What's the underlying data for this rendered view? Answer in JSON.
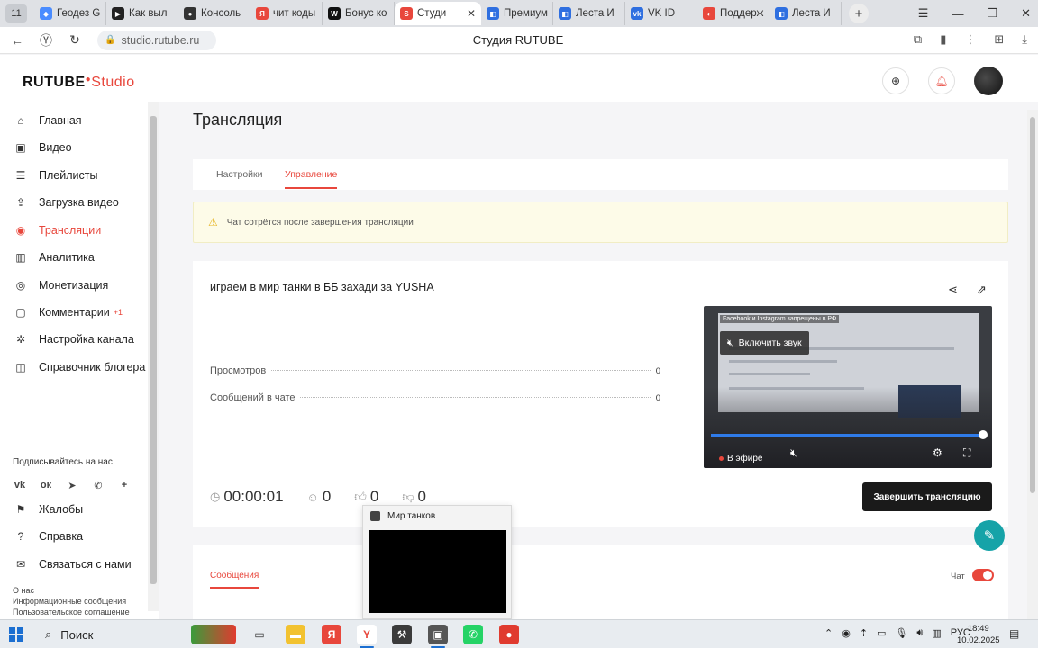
{
  "browser": {
    "tab_count": "11",
    "tabs": [
      {
        "label": "Геодез G",
        "color": "#4a8cff",
        "glyph": "◆"
      },
      {
        "label": "Как выл",
        "color": "#222222",
        "glyph": "▶"
      },
      {
        "label": "Консоль",
        "color": "#333333",
        "glyph": "●"
      },
      {
        "label": "чит коды",
        "color": "#e8473c",
        "glyph": "Я"
      },
      {
        "label": "Бонус ко",
        "color": "#111111",
        "glyph": "W"
      },
      {
        "label": "Студи",
        "color": "#e8473c",
        "glyph": "S"
      },
      {
        "label": "Премиум",
        "color": "#2f6fe0",
        "glyph": "◧"
      },
      {
        "label": "Леста И",
        "color": "#2f6fe0",
        "glyph": "◧"
      },
      {
        "label": "VK ID",
        "color": "#2f6fe0",
        "glyph": "vk"
      },
      {
        "label": "Поддерж",
        "color": "#e8473c",
        "glyph": "◐"
      },
      {
        "label": "Леста И",
        "color": "#2f6fe0",
        "glyph": "◧"
      }
    ],
    "url": "studio.rutube.ru",
    "page_title": "Студия RUTUBE"
  },
  "logo": {
    "brand": "RUTUBE",
    "suffix": "Studio"
  },
  "sidebar": {
    "items": [
      {
        "label": "Главная",
        "icon": "home-icon",
        "glyph": "⌂"
      },
      {
        "label": "Видео",
        "icon": "video-icon",
        "glyph": "▣"
      },
      {
        "label": "Плейлисты",
        "icon": "playlist-icon",
        "glyph": "☰"
      },
      {
        "label": "Загрузка видео",
        "icon": "upload-icon",
        "glyph": "⇪"
      },
      {
        "label": "Трансляции",
        "icon": "broadcast-icon",
        "glyph": "◉"
      },
      {
        "label": "Аналитика",
        "icon": "analytics-icon",
        "glyph": "▥"
      },
      {
        "label": "Монетизация",
        "icon": "monetization-icon",
        "glyph": "◎"
      },
      {
        "label": "Комментарии",
        "icon": "comments-icon",
        "glyph": "▢",
        "badge": "+1"
      },
      {
        "label": "Настройка канала",
        "icon": "settings-icon",
        "glyph": "✲"
      },
      {
        "label": "Справочник блогера",
        "icon": "book-icon",
        "glyph": "◫"
      }
    ],
    "subscribe_label": "Подписывайтесь на нас",
    "socials": [
      {
        "name": "vk-icon",
        "glyph": "vk"
      },
      {
        "name": "ok-icon",
        "glyph": "ок"
      },
      {
        "name": "telegram-icon",
        "glyph": "➤"
      },
      {
        "name": "viber-icon",
        "glyph": "✆"
      },
      {
        "name": "plus-icon",
        "glyph": "+"
      }
    ],
    "bottom_items": [
      {
        "label": "Жалобы",
        "icon": "flag-icon",
        "glyph": "⚑"
      },
      {
        "label": "Справка",
        "icon": "help-icon",
        "glyph": "?"
      },
      {
        "label": "Связаться с нами",
        "icon": "contact-icon",
        "glyph": "✉"
      }
    ],
    "footer_links": [
      "О нас",
      "Информационные сообщения",
      "Пользовательское соглашение"
    ]
  },
  "page": {
    "title": "Трансляция",
    "tabs": [
      "Настройки",
      "Управление"
    ],
    "active_tab": 1,
    "warning": "Чат сотрётся после завершения трансляции"
  },
  "stream": {
    "title": "играем в мир танки в ББ захади за YUSHA",
    "stats": [
      {
        "label": "Просмотров",
        "value": "0"
      },
      {
        "label": "Сообщений в чате",
        "value": "0"
      }
    ],
    "timer": "00:00:01",
    "viewers": "0",
    "likes": "0",
    "dislikes": "0",
    "end_button": "Завершить трансляцию"
  },
  "player": {
    "fb_notice": "Facebook и Instagram запрещены в РФ",
    "unmute_label": "Включить звук",
    "live_label": "В эфире",
    "progress": 1.0
  },
  "messages": {
    "tab_label": "Сообщения",
    "chat_label": "Чат",
    "chat_enabled": true
  },
  "preview_popup": {
    "title": "Мир танков"
  },
  "taskbar": {
    "search_label": "Поиск",
    "language": "РУС",
    "time": "18:49",
    "date": "10.02.2025"
  },
  "colors": {
    "accent": "#e8473c",
    "teal": "#16a3a8"
  }
}
